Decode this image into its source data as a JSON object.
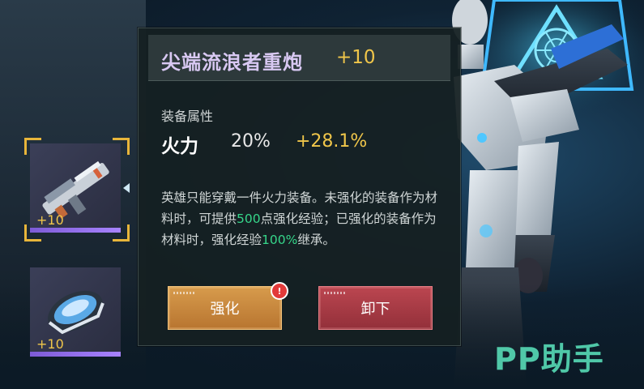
{
  "item": {
    "name": "尖端流浪者重炮",
    "level": "+10"
  },
  "attributes": {
    "title": "装备属性",
    "stat_name": "火力",
    "base_value": "20%",
    "bonus_value": "+28.1%"
  },
  "description": {
    "part1": "英雄只能穿戴一件火力装备。未强化的装备作为材料时，可提供",
    "hl1": "500",
    "part2": "点强化经验；已强化的装备作为材料时，强化经验",
    "hl2": "100%",
    "part3": "继承。"
  },
  "buttons": {
    "enhance": "强化",
    "unload": "卸下",
    "alert": "!"
  },
  "slots": [
    {
      "level": "+10",
      "icon": "heavy-cannon-icon"
    },
    {
      "level": "+10",
      "icon": "armor-module-icon"
    }
  ],
  "watermark": "PP助手",
  "colors": {
    "gold": "#f0c64a",
    "accent_green": "#36d68a",
    "name_purple": "#d8c8f2",
    "enhance": "#d79b4c",
    "unload": "#bb4650"
  }
}
